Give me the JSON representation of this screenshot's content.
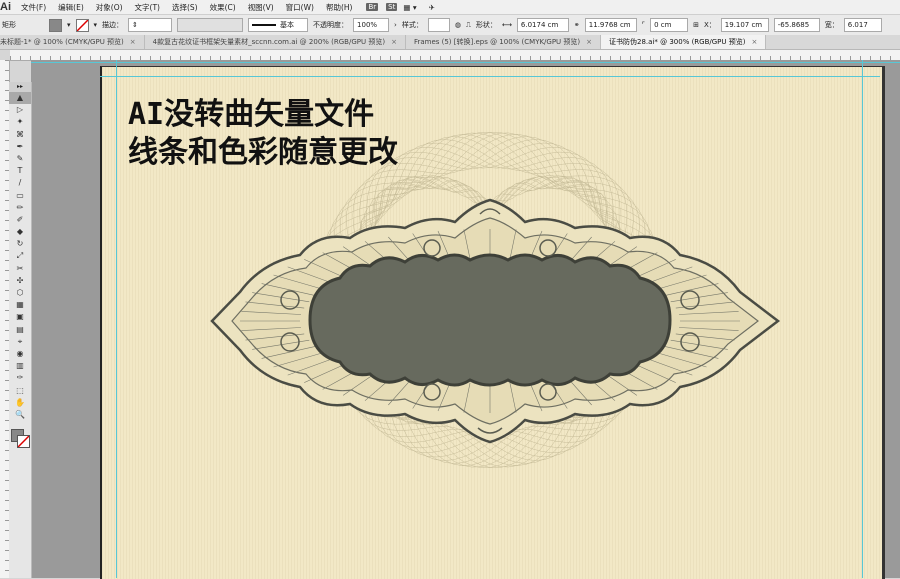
{
  "menubar": {
    "app_logo": "Ai",
    "items": [
      "文件(F)",
      "编辑(E)",
      "对象(O)",
      "文字(T)",
      "选择(S)",
      "效果(C)",
      "视图(V)",
      "窗口(W)",
      "帮助(H)"
    ],
    "chips": [
      "Br",
      "St"
    ]
  },
  "controlbar": {
    "object_type": "矩形",
    "stroke_label": "描边：",
    "brush_label": "基本",
    "opacity_label": "不透明度：",
    "opacity_value": "100%",
    "style_label": "样式：",
    "shape_label": "形状：",
    "w_value": "6.0174 cm",
    "h_value": "11.9768 cm",
    "corner_value": "0 cm",
    "x_label": "X：",
    "x_value": "19.107 cm",
    "y_value": "-65.8685",
    "width_label": "宽：",
    "width_value": "6.017"
  },
  "tabs": [
    {
      "label": "未标题-1* @ 100% (CMYK/GPU 预览)",
      "active": false
    },
    {
      "label": "4款复古花纹证书框架矢量素材_sccnn.com.ai @ 200% (RGB/GPU 预览)",
      "active": false
    },
    {
      "label": "Frames (5) [转换].eps @ 100% (CMYK/GPU 预览)",
      "active": false
    },
    {
      "label": "证书防伪28.ai* @ 300% (RGB/GPU 预览)",
      "active": true
    }
  ],
  "toolbar": {
    "header": "▸▸",
    "tools": [
      "▲",
      "▷",
      "✦",
      "⌘",
      "✒",
      "✎",
      "T",
      "/",
      "▭",
      "✏",
      "✐",
      "◆",
      "↻",
      "⤢",
      "✂",
      "✣",
      "⬡",
      "▦",
      "▣",
      "▤",
      "⌖",
      "◉",
      "▥",
      "✑",
      "⬚",
      "✋",
      "🔍"
    ]
  },
  "canvas": {
    "headline_line1": "AI没转曲矢量文件",
    "headline_line2": "线条和色彩随意更改"
  },
  "colors": {
    "artboard": "#f2e8c6",
    "emblem_dark": "#676a5e",
    "guide": "#57c7d6"
  }
}
